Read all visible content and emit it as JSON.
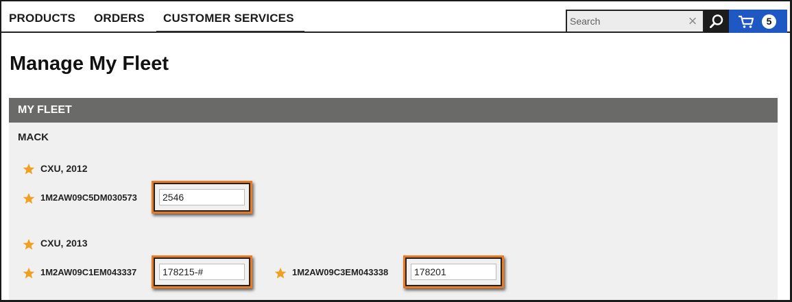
{
  "nav": {
    "tabs": [
      {
        "label": "PRODUCTS"
      },
      {
        "label": "ORDERS"
      },
      {
        "label": "CUSTOMER SERVICES",
        "active": true
      }
    ],
    "search": {
      "placeholder": "Search",
      "value": ""
    },
    "cart": {
      "count": "5"
    },
    "colors": {
      "cart_bg": "#1f57c3",
      "search_btn_bg": "#1c1c1c"
    }
  },
  "page": {
    "title": "Manage My Fleet"
  },
  "fleet": {
    "header": "MY FLEET",
    "make": "MACK",
    "groups": [
      {
        "model": "CXU, 2012",
        "vehicles": [
          {
            "vin": "1M2AW09C5DM030573",
            "unit": "2546"
          }
        ]
      },
      {
        "model": "CXU, 2013",
        "vehicles": [
          {
            "vin": "1M2AW09C1EM043337",
            "unit": "178215-#"
          },
          {
            "vin": "1M2AW09C3EM043338",
            "unit": "178201"
          }
        ]
      }
    ],
    "colors": {
      "header_bg": "#6a6a68",
      "star": "#f0a020",
      "highlight": "#ea7a22"
    }
  }
}
